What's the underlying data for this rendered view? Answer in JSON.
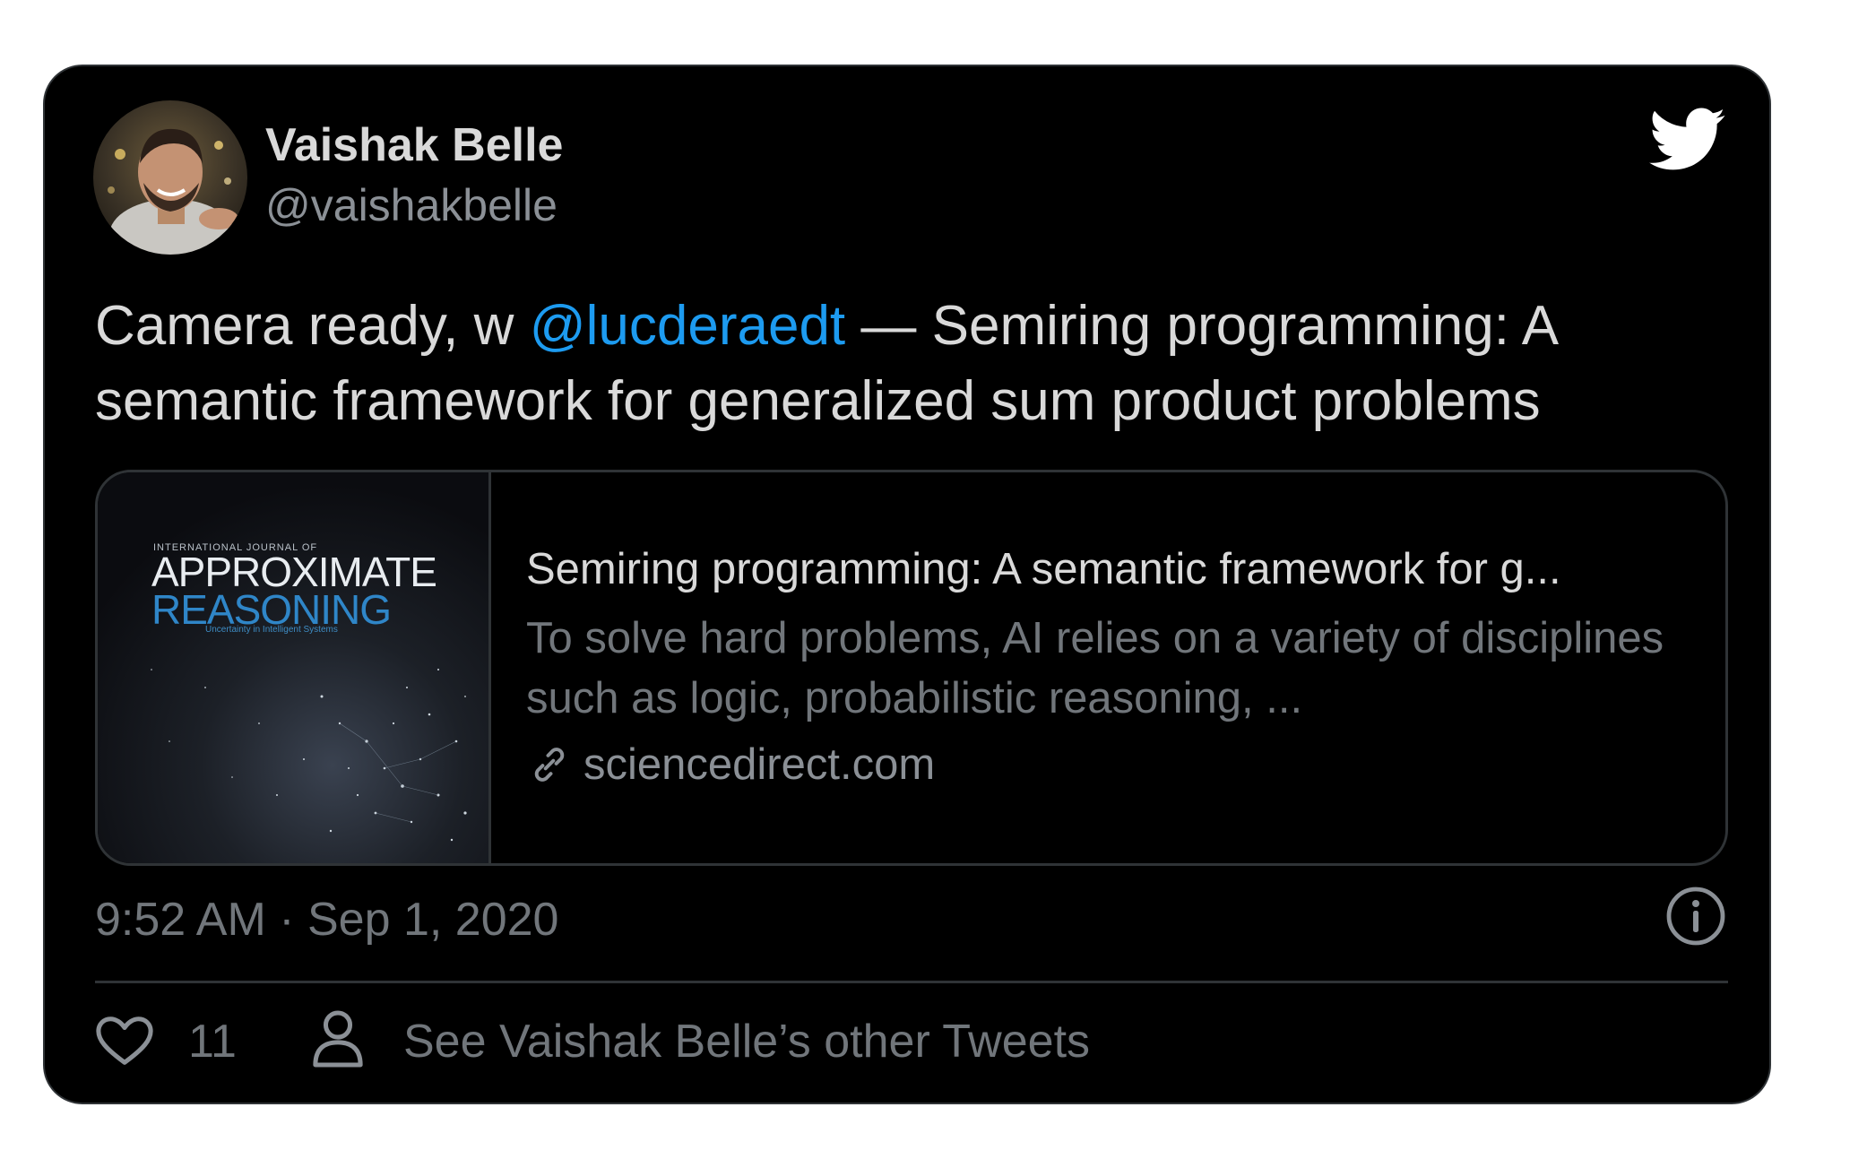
{
  "author": {
    "display_name": "Vaishak Belle",
    "handle": "@vaishakbelle"
  },
  "tweet": {
    "text_prefix": "Camera ready, w ",
    "mention": "@lucderaedt",
    "text_suffix": " — Semiring programming: A semantic framework for generalized sum product problems"
  },
  "link_card": {
    "thumbnail": {
      "journal_small": "INTERNATIONAL JOURNAL OF",
      "title_line1": "APPROXIMATE",
      "title_line2": "REASONING",
      "subtitle": "Uncertainty in Intelligent Systems"
    },
    "title": "Semiring programming: A semantic framework for g...",
    "description": "To solve hard problems, AI relies on a variety of disciplines such as logic, probabilistic reasoning, ...",
    "domain": "sciencedirect.com"
  },
  "timestamp": "9:52 AM · Sep 1, 2020",
  "footer": {
    "like_count": "11",
    "other_tweets_label": "See Vaishak Belle’s other Tweets"
  },
  "colors": {
    "background": "#000000",
    "text": "#d9d9d9",
    "secondary": "#71767b",
    "accent": "#1d9bf0",
    "border": "#2f3336"
  },
  "icons": [
    "twitter-bird-icon",
    "link-icon",
    "info-icon",
    "heart-icon",
    "person-icon"
  ]
}
